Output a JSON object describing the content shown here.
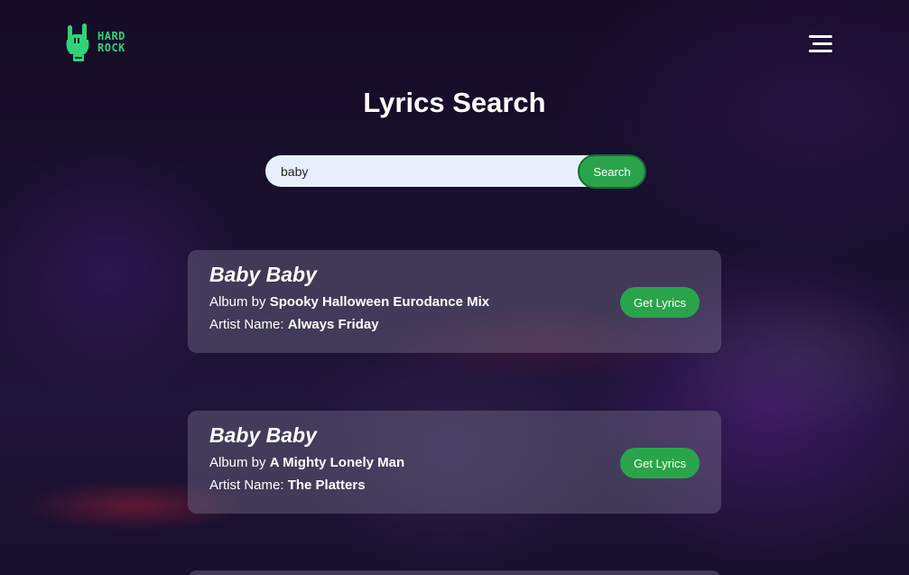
{
  "brand": {
    "line1": "HARD",
    "line2": "ROCK",
    "logo_icon": "rock-hand-icon",
    "color": "#2fd37a"
  },
  "header": {
    "menu_icon": "hamburger-menu-icon"
  },
  "page": {
    "title": "Lyrics Search"
  },
  "search": {
    "value": "baby",
    "button_label": "Search",
    "accent": "#2aa44b"
  },
  "results": [
    {
      "song": "Baby Baby",
      "album_label": "Album by",
      "album": "Spooky Halloween Eurodance Mix",
      "artist_label": "Artist Name:",
      "artist": "Always Friday",
      "button_label": "Get Lyrics"
    },
    {
      "song": "Baby Baby",
      "album_label": "Album by",
      "album": "A Mighty Lonely Man",
      "artist_label": "Artist Name:",
      "artist": "The Platters",
      "button_label": "Get Lyrics"
    }
  ]
}
